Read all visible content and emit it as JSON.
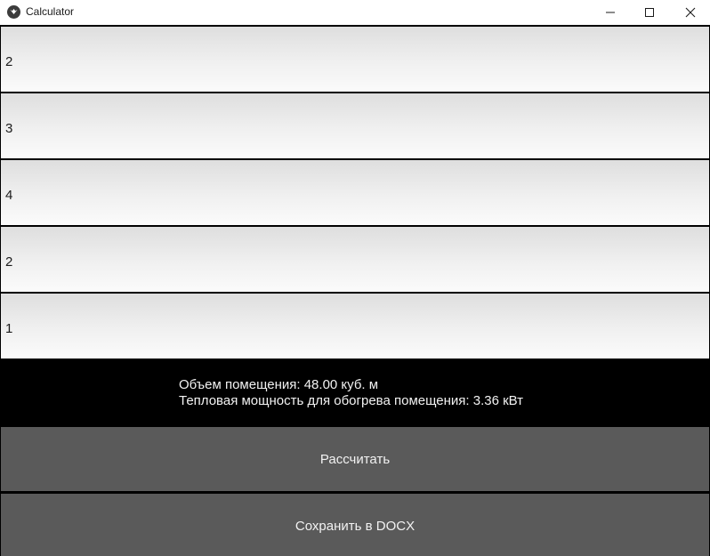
{
  "window": {
    "title": "Calculator",
    "controls": [
      "minimize",
      "maximize",
      "close"
    ]
  },
  "inputs": [
    {
      "value": "2"
    },
    {
      "value": "3"
    },
    {
      "value": "4"
    },
    {
      "value": "2"
    },
    {
      "value": "1"
    }
  ],
  "result": {
    "volume_text": "Объем помещения: 48.00 куб. м",
    "power_text": "Тепловая мощность для обогрева помещения: 3.36 кВт"
  },
  "buttons": {
    "calculate_label": "Рассчитать",
    "save_label": "Сохранить в DOCX"
  },
  "colors": {
    "button_bg": "#5a5a5a",
    "result_bg": "#000000",
    "text_light": "#f2f2f2"
  }
}
